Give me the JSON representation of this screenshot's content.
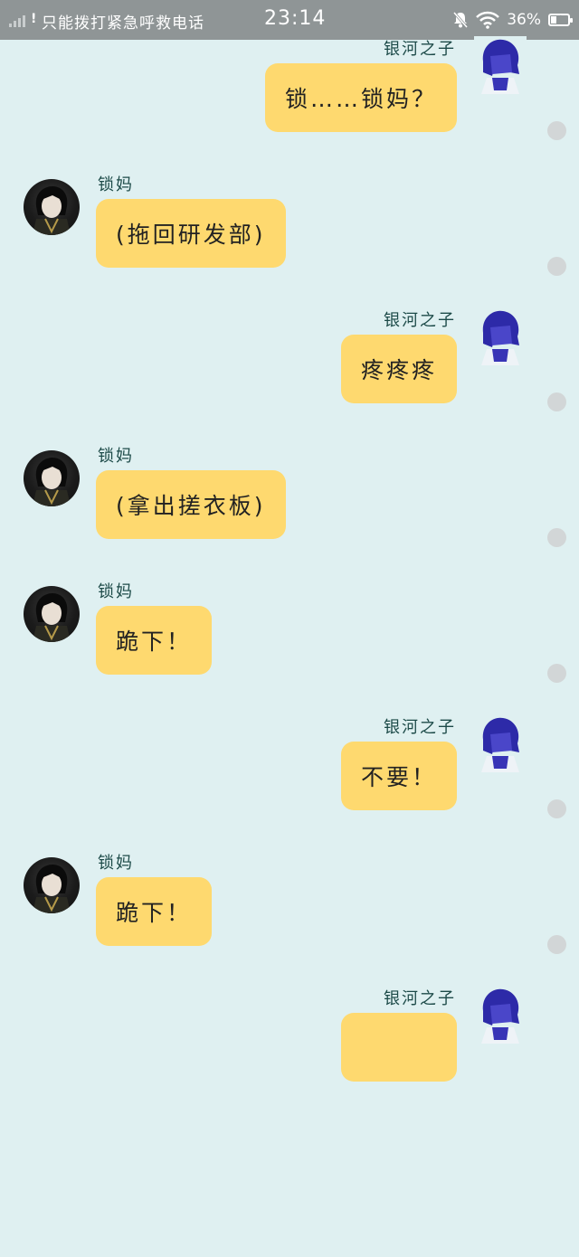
{
  "status_bar": {
    "signal_mark": "!",
    "carrier_text": "只能拨打紧急呼救电话",
    "time": "23:14",
    "battery_percent": "36%",
    "icons": [
      "signal-icon",
      "mute-bell-icon",
      "wifi-icon",
      "battery-charging-icon"
    ]
  },
  "colors": {
    "background": "#dff0f1",
    "status_bar": "#8f9596",
    "bubble": "#fed96f",
    "name_text": "#1c4a48",
    "dot": "#d2d6d7"
  },
  "messages": [
    {
      "side": "right",
      "sender": "银河之子",
      "text": "锁……锁妈？"
    },
    {
      "side": "left",
      "sender": "锁妈",
      "text": "(拖回研发部)"
    },
    {
      "side": "right",
      "sender": "银河之子",
      "text": "疼疼疼"
    },
    {
      "side": "left",
      "sender": "锁妈",
      "text": "(拿出搓衣板)"
    },
    {
      "side": "left",
      "sender": "锁妈",
      "text": "跪下！"
    },
    {
      "side": "right",
      "sender": "银河之子",
      "text": "不要！"
    },
    {
      "side": "left",
      "sender": "锁妈",
      "text": "跪下！"
    },
    {
      "side": "right",
      "sender": "银河之子",
      "text": ""
    }
  ]
}
